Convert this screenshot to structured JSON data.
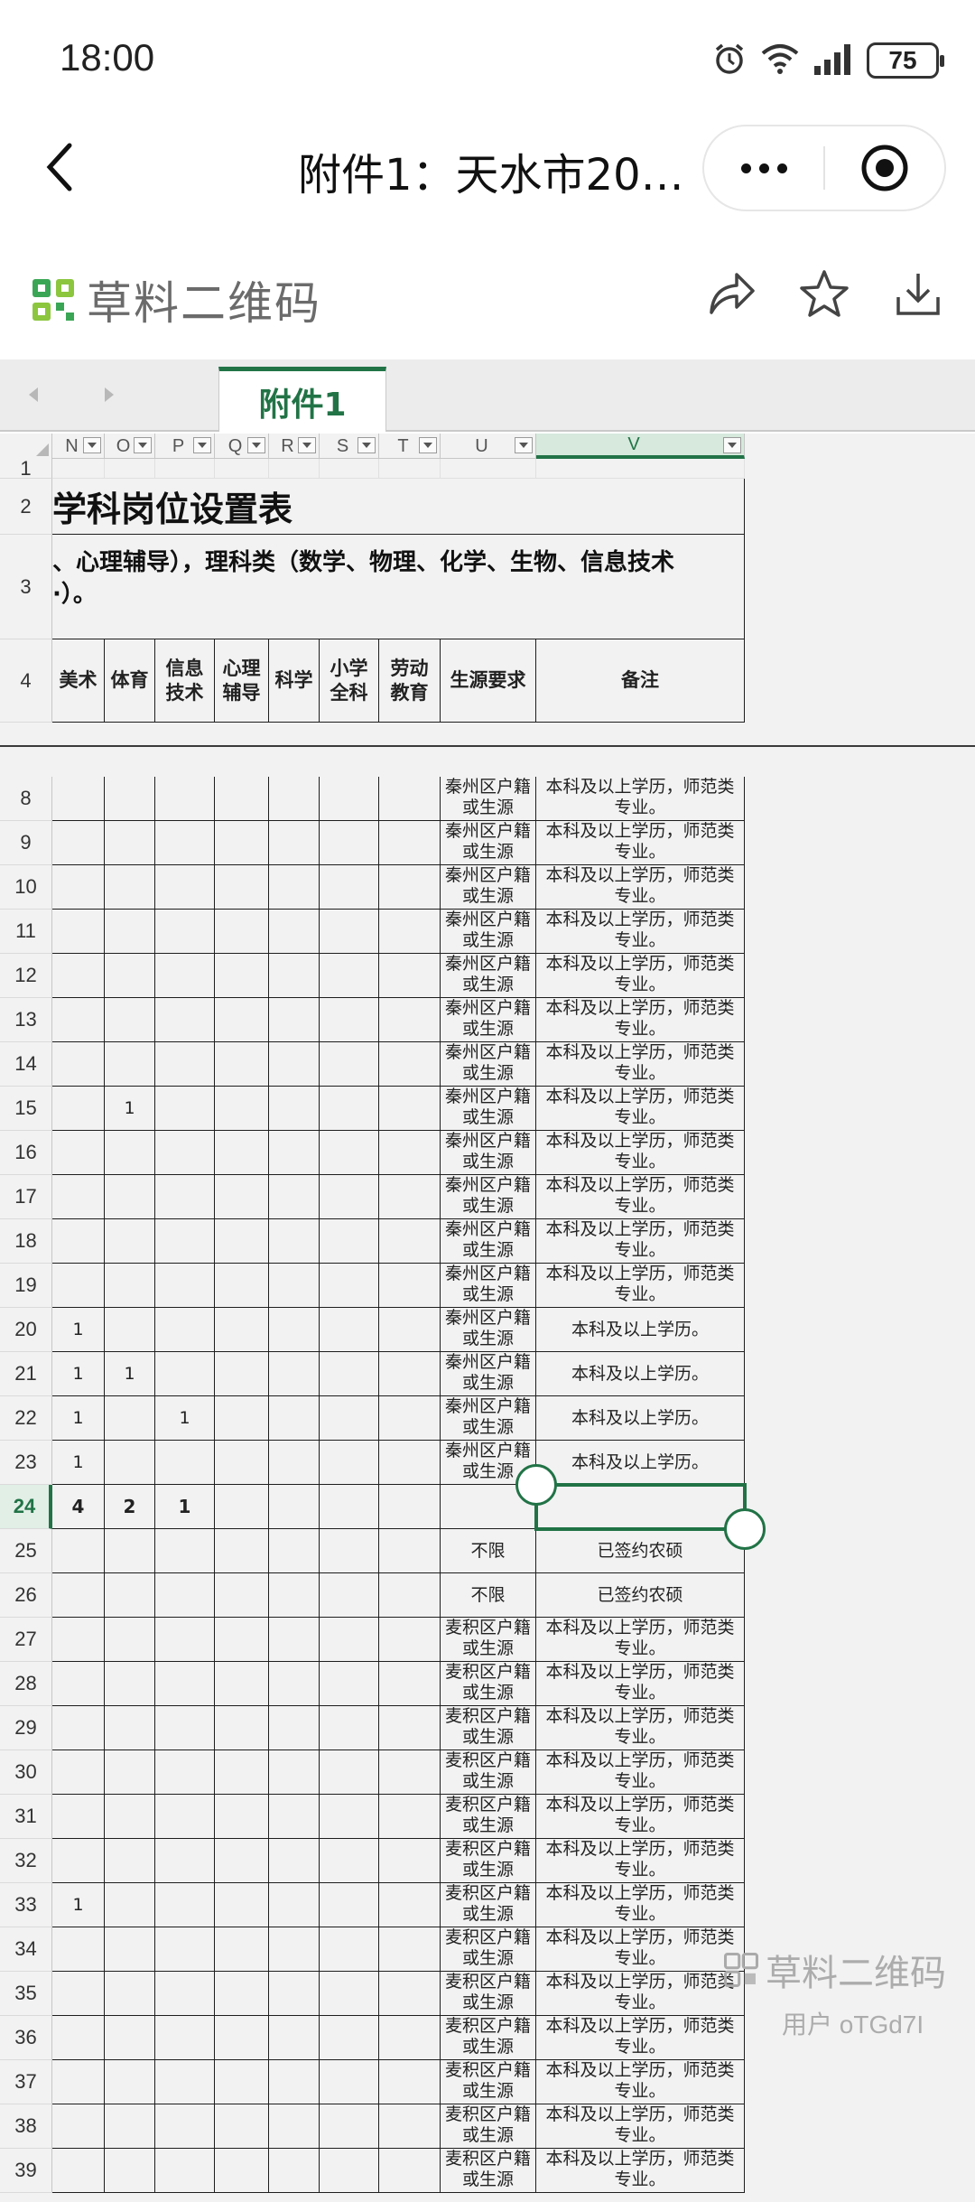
{
  "status": {
    "time": "18:00",
    "battery": "75"
  },
  "nav": {
    "title": "附件1：天水市20…"
  },
  "brand": {
    "name": "草料二维码",
    "accent": "#217346"
  },
  "sheet": {
    "prev_icon": "triangle-left-icon",
    "next_icon": "triangle-right-icon",
    "tab_label": "附件1"
  },
  "columns": [
    {
      "letter": "N",
      "filter": true
    },
    {
      "letter": "O",
      "filter": true
    },
    {
      "letter": "P",
      "filter": true
    },
    {
      "letter": "Q",
      "filter": true
    },
    {
      "letter": "R",
      "filter": true
    },
    {
      "letter": "S",
      "filter": true
    },
    {
      "letter": "T",
      "filter": true
    },
    {
      "letter": "U",
      "filter": true
    },
    {
      "letter": "V",
      "filter": true
    }
  ],
  "rows": {
    "r2_title": "学科岗位设置表",
    "r3_line1": "、心理辅导），理科类（数学、物理、化学、生物、信息技术",
    "r3_line2": "·）。",
    "r4_headers": [
      "美术",
      "体育",
      "信息\n技术",
      "心理\n辅导",
      "科学",
      "小学\n全科",
      "劳动\n教育",
      "生源要求",
      "备注"
    ],
    "data": [
      {
        "num": "8",
        "vals": [
          "",
          "",
          "",
          "",
          "",
          "",
          ""
        ],
        "req": "秦州区户籍或生源",
        "note": "本科及以上学历，师范类专业。"
      },
      {
        "num": "9",
        "vals": [
          "",
          "",
          "",
          "",
          "",
          "",
          ""
        ],
        "req": "秦州区户籍或生源",
        "note": "本科及以上学历，师范类专业。"
      },
      {
        "num": "10",
        "vals": [
          "",
          "",
          "",
          "",
          "",
          "",
          ""
        ],
        "req": "秦州区户籍或生源",
        "note": "本科及以上学历，师范类专业。"
      },
      {
        "num": "11",
        "vals": [
          "",
          "",
          "",
          "",
          "",
          "",
          ""
        ],
        "req": "秦州区户籍或生源",
        "note": "本科及以上学历，师范类专业。"
      },
      {
        "num": "12",
        "vals": [
          "",
          "",
          "",
          "",
          "",
          "",
          ""
        ],
        "req": "秦州区户籍或生源",
        "note": "本科及以上学历，师范类专业。"
      },
      {
        "num": "13",
        "vals": [
          "",
          "",
          "",
          "",
          "",
          "",
          ""
        ],
        "req": "秦州区户籍或生源",
        "note": "本科及以上学历，师范类专业。"
      },
      {
        "num": "14",
        "vals": [
          "",
          "",
          "",
          "",
          "",
          "",
          ""
        ],
        "req": "秦州区户籍或生源",
        "note": "本科及以上学历，师范类专业。"
      },
      {
        "num": "15",
        "vals": [
          "",
          "1",
          "",
          "",
          "",
          "",
          ""
        ],
        "req": "秦州区户籍或生源",
        "note": "本科及以上学历，师范类专业。"
      },
      {
        "num": "16",
        "vals": [
          "",
          "",
          "",
          "",
          "",
          "",
          ""
        ],
        "req": "秦州区户籍或生源",
        "note": "本科及以上学历，师范类专业。"
      },
      {
        "num": "17",
        "vals": [
          "",
          "",
          "",
          "",
          "",
          "",
          ""
        ],
        "req": "秦州区户籍或生源",
        "note": "本科及以上学历，师范类专业。"
      },
      {
        "num": "18",
        "vals": [
          "",
          "",
          "",
          "",
          "",
          "",
          ""
        ],
        "req": "秦州区户籍或生源",
        "note": "本科及以上学历，师范类专业。"
      },
      {
        "num": "19",
        "vals": [
          "",
          "",
          "",
          "",
          "",
          "",
          ""
        ],
        "req": "秦州区户籍或生源",
        "note": "本科及以上学历，师范类专业。"
      },
      {
        "num": "20",
        "vals": [
          "1",
          "",
          "",
          "",
          "",
          "",
          ""
        ],
        "req": "秦州区户籍或生源",
        "note": "本科及以上学历。"
      },
      {
        "num": "21",
        "vals": [
          "1",
          "1",
          "",
          "",
          "",
          "",
          ""
        ],
        "req": "秦州区户籍或生源",
        "note": "本科及以上学历。"
      },
      {
        "num": "22",
        "vals": [
          "1",
          "",
          "1",
          "",
          "",
          "",
          ""
        ],
        "req": "秦州区户籍或生源",
        "note": "本科及以上学历。"
      },
      {
        "num": "23",
        "vals": [
          "1",
          "",
          "",
          "",
          "",
          "",
          ""
        ],
        "req": "秦州区户籍或生源",
        "note": "本科及以上学历。"
      },
      {
        "num": "24",
        "vals": [
          "4",
          "2",
          "1",
          "",
          "",
          "",
          ""
        ],
        "req": "",
        "note": "",
        "total": true
      },
      {
        "num": "25",
        "vals": [
          "",
          "",
          "",
          "",
          "",
          "",
          ""
        ],
        "req": "不限",
        "note": "已签约农硕"
      },
      {
        "num": "26",
        "vals": [
          "",
          "",
          "",
          "",
          "",
          "",
          ""
        ],
        "req": "不限",
        "note": "已签约农硕"
      },
      {
        "num": "27",
        "vals": [
          "",
          "",
          "",
          "",
          "",
          "",
          ""
        ],
        "req": "麦积区户籍或生源",
        "note": "本科及以上学历，师范类专业。"
      },
      {
        "num": "28",
        "vals": [
          "",
          "",
          "",
          "",
          "",
          "",
          ""
        ],
        "req": "麦积区户籍或生源",
        "note": "本科及以上学历，师范类专业。"
      },
      {
        "num": "29",
        "vals": [
          "",
          "",
          "",
          "",
          "",
          "",
          ""
        ],
        "req": "麦积区户籍或生源",
        "note": "本科及以上学历，师范类专业。"
      },
      {
        "num": "30",
        "vals": [
          "",
          "",
          "",
          "",
          "",
          "",
          ""
        ],
        "req": "麦积区户籍或生源",
        "note": "本科及以上学历，师范类专业。"
      },
      {
        "num": "31",
        "vals": [
          "",
          "",
          "",
          "",
          "",
          "",
          ""
        ],
        "req": "麦积区户籍或生源",
        "note": "本科及以上学历，师范类专业。"
      },
      {
        "num": "32",
        "vals": [
          "",
          "",
          "",
          "",
          "",
          "",
          ""
        ],
        "req": "麦积区户籍或生源",
        "note": "本科及以上学历，师范类专业。"
      },
      {
        "num": "33",
        "vals": [
          "1",
          "",
          "",
          "",
          "",
          "",
          ""
        ],
        "req": "麦积区户籍或生源",
        "note": "本科及以上学历，师范类专业。"
      },
      {
        "num": "34",
        "vals": [
          "",
          "",
          "",
          "",
          "",
          "",
          ""
        ],
        "req": "麦积区户籍或生源",
        "note": "本科及以上学历，师范类专业。"
      },
      {
        "num": "35",
        "vals": [
          "",
          "",
          "",
          "",
          "",
          "",
          ""
        ],
        "req": "麦积区户籍或生源",
        "note": "本科及以上学历，师范类专业。"
      },
      {
        "num": "36",
        "vals": [
          "",
          "",
          "",
          "",
          "",
          "",
          ""
        ],
        "req": "麦积区户籍或生源",
        "note": "本科及以上学历，师范类专业。"
      },
      {
        "num": "37",
        "vals": [
          "",
          "",
          "",
          "",
          "",
          "",
          ""
        ],
        "req": "麦积区户籍或生源",
        "note": "本科及以上学历，师范类专业。"
      },
      {
        "num": "38",
        "vals": [
          "",
          "",
          "",
          "",
          "",
          "",
          ""
        ],
        "req": "麦积区户籍或生源",
        "note": "本科及以上学历，师范类专业。"
      },
      {
        "num": "39",
        "vals": [
          "",
          "",
          "",
          "",
          "",
          "",
          ""
        ],
        "req": "麦积区户籍或生源",
        "note": "本科及以上学历，师范类专业。"
      }
    ]
  },
  "watermark": {
    "brand": "草料二维码",
    "user": "用户 oTGd7I"
  }
}
